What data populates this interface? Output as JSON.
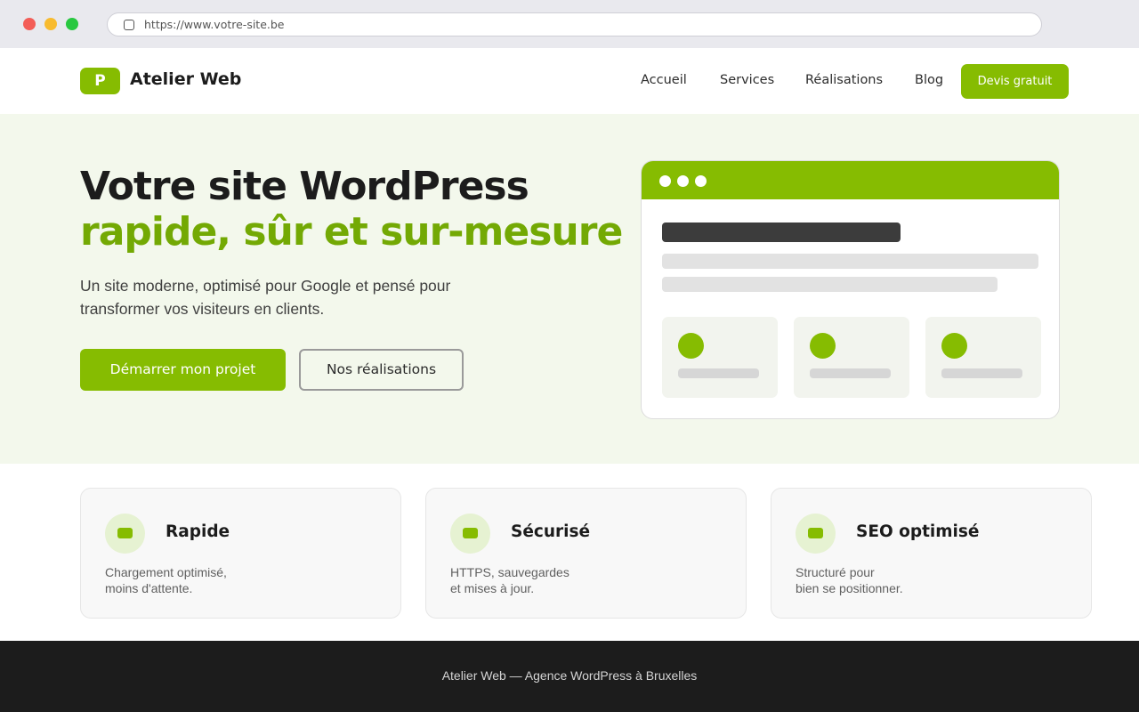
{
  "browser": {
    "url": "https://www.votre-site.be"
  },
  "header": {
    "logo_letter": "P",
    "logo_text": "Atelier Web",
    "nav": [
      "Accueil",
      "Services",
      "Réalisations",
      "Blog"
    ],
    "cta": "Devis gratuit"
  },
  "hero": {
    "title_line1": "Votre site WordPress",
    "title_line2": "rapide, sûr et sur-mesure",
    "description": "Un site moderne, optimisé pour Google et pensé pour transformer vos visiteurs en clients.",
    "primary_button": "Démarrer mon projet",
    "secondary_button": "Nos réalisations"
  },
  "features": [
    {
      "title": "Rapide",
      "desc_line1": "Chargement optimisé,",
      "desc_line2": "moins d'attente.",
      "icon": "speed-icon"
    },
    {
      "title": "Sécurisé",
      "desc_line1": "HTTPS, sauvegardes",
      "desc_line2": "et mises à jour.",
      "icon": "shield-icon"
    },
    {
      "title": "SEO optimisé",
      "desc_line1": "Structuré pour",
      "desc_line2": "bien se positionner.",
      "icon": "seo-icon"
    }
  ],
  "footer": {
    "text": "Atelier Web — Agence WordPress à Bruxelles"
  },
  "colors": {
    "accent": "#86bc01",
    "accent_dark": "#73a904",
    "hero_bg": "#f3f8ec",
    "footer_bg": "#1c1c1c"
  }
}
